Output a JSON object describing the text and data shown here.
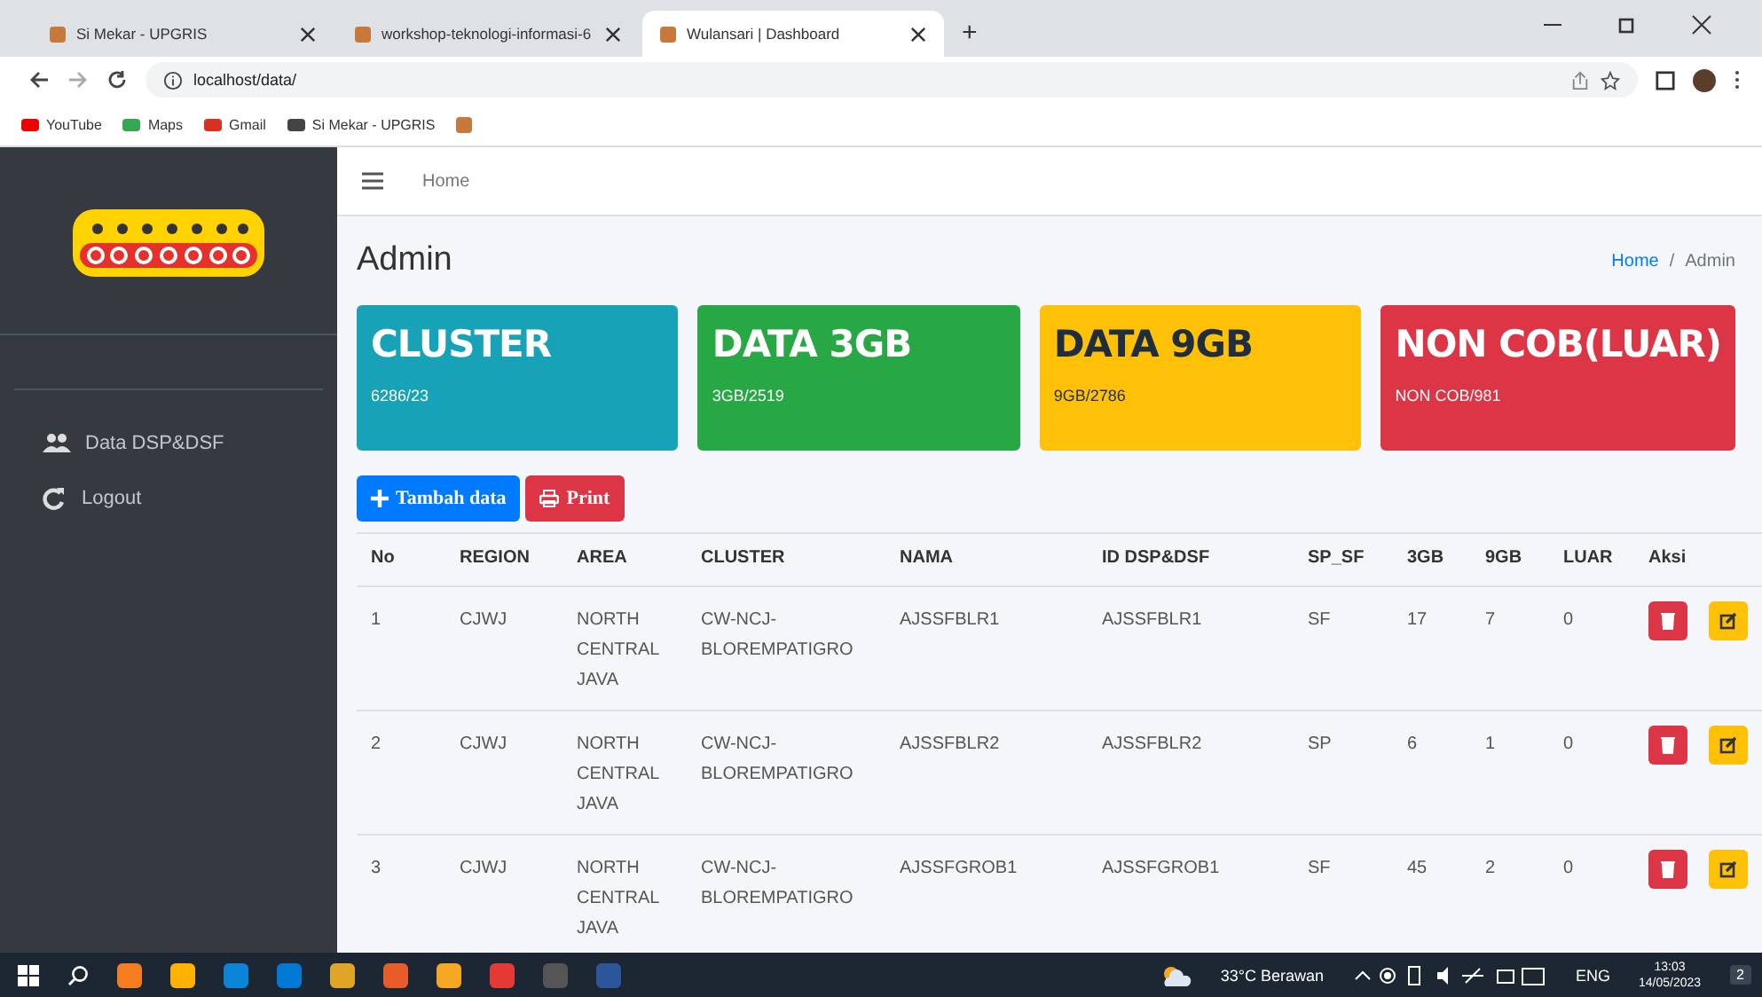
{
  "browser": {
    "tabs": [
      {
        "title": "Si Mekar - UPGRIS",
        "selected": false
      },
      {
        "title": "workshop-teknologi-informasi-6",
        "selected": false
      },
      {
        "title": "Wulansari | Dashboard",
        "selected": true
      }
    ],
    "new_tab": "+",
    "address": "localhost/data/",
    "bookmarks": [
      "YouTube",
      "Maps",
      "Gmail",
      "Si Mekar - UPGRIS"
    ]
  },
  "sidebar": {
    "items": [
      {
        "label": "Data DSP&DSF",
        "kind": "users"
      },
      {
        "label": "Logout",
        "kind": "logout"
      }
    ]
  },
  "navbar": {
    "link": "Home"
  },
  "page_title": "Admin",
  "breadcrumb": {
    "link": "Home",
    "separator": "/",
    "current": "Admin"
  },
  "cards": [
    {
      "title": "CLUSTER",
      "subtitle": "6286/23",
      "color": "#17a2b8"
    },
    {
      "title": "DATA 3GB",
      "subtitle": "3GB/2519",
      "color": "#28a745"
    },
    {
      "title": "DATA 9GB",
      "subtitle": "9GB/2786",
      "color": "#ffc107"
    },
    {
      "title": "NON COB(LUAR)",
      "subtitle": "NON COB/981",
      "color": "#dc3545"
    }
  ],
  "buttons": [
    {
      "label": "Tambah data",
      "kind": "add"
    },
    {
      "label": "Print",
      "kind": "print"
    }
  ],
  "table": {
    "columns": [
      "No",
      "REGION",
      "AREA",
      "CLUSTER",
      "NAMA",
      "ID DSP&DSF",
      "SP_SF",
      "3GB",
      "9GB",
      "LUAR",
      "Aksi"
    ],
    "rows": [
      {
        "cells": [
          "1",
          "CJWJ",
          "NORTH CENTRAL JAVA",
          "CW-NCJ-BLOREMPATIGRO",
          "AJSSFBLR1",
          "AJSSFBLR1",
          "SF",
          "17",
          "7",
          "0"
        ]
      },
      {
        "cells": [
          "2",
          "CJWJ",
          "NORTH CENTRAL JAVA",
          "CW-NCJ-BLOREMPATIGRO",
          "AJSSFBLR2",
          "AJSSFBLR2",
          "SP",
          "6",
          "1",
          "0"
        ]
      },
      {
        "cells": [
          "3",
          "CJWJ",
          "NORTH CENTRAL JAVA",
          "CW-NCJ-BLOREMPATIGRO",
          "AJSSFGROB1",
          "AJSSFGROB1",
          "SF",
          "45",
          "2",
          "0"
        ]
      }
    ]
  },
  "taskbar": {
    "weather": "33°C Berawan",
    "language": "ENG",
    "time": "13:03",
    "date": "14/05/2023",
    "notifications": "2"
  }
}
